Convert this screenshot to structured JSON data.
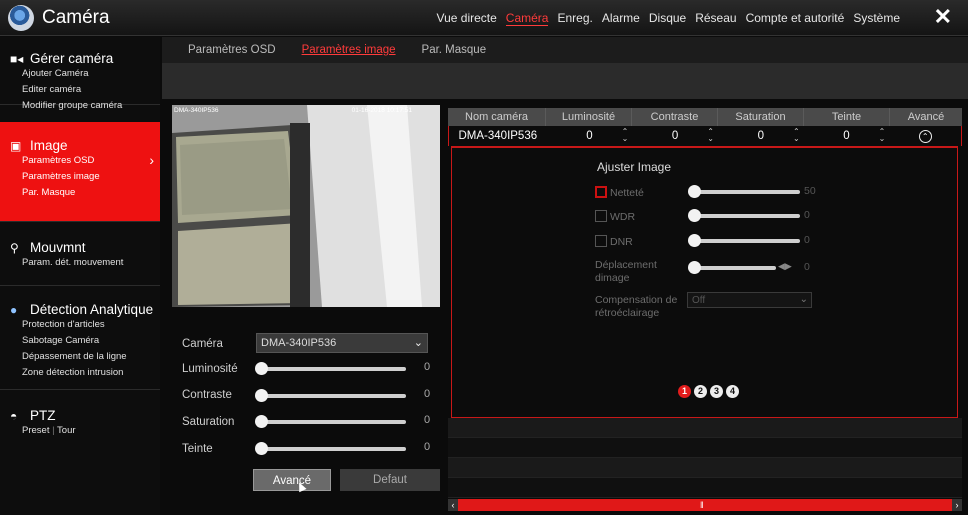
{
  "app": {
    "title": "Caméra"
  },
  "topnav": [
    "Vue directe",
    "Caméra",
    "Enreg.",
    "Alarme",
    "Disque",
    "Réseau",
    "Compte et autorité",
    "Système"
  ],
  "topnav_active": 1,
  "sidebar": {
    "gerer": {
      "title": "Gérer caméra",
      "items": [
        "Ajouter Caméra",
        "Editer caméra",
        "Modifier groupe caméra"
      ]
    },
    "image": {
      "title": "Image",
      "items": [
        "Paramètres OSD",
        "Paramètres image",
        "Par. Masque"
      ]
    },
    "mouvement": {
      "title": "Mouvmnt",
      "items": [
        "Param. dét. mouvement"
      ]
    },
    "detection": {
      "title": "Détection Analytique",
      "items": [
        "Protection d'articles",
        "Sabotage Caméra",
        "Dépassement de la ligne",
        "Zone détection intrusion"
      ]
    },
    "ptz": {
      "title": "PTZ",
      "items": [
        "Preset",
        "Tour"
      ],
      "separator": "|"
    }
  },
  "subtabs": [
    "Paramètres OSD",
    "Paramètres image",
    "Par. Masque"
  ],
  "subtabs_active": 1,
  "preview": {
    "osd_name": "DMA-340IP536",
    "osd_time": "01-16-2018 10:17:51"
  },
  "form": {
    "camera_label": "Caméra",
    "camera_value": "DMA-340IP536",
    "luminosite_label": "Luminosité",
    "luminosite_value": "0",
    "contraste_label": "Contraste",
    "contraste_value": "0",
    "saturation_label": "Saturation",
    "saturation_value": "0",
    "teinte_label": "Teinte",
    "teinte_value": "0",
    "btn_avance": "Avancé",
    "btn_defaut": "Defaut"
  },
  "table": {
    "headers": [
      "Nom caméra",
      "Luminosité",
      "Contraste",
      "Saturation",
      "Teinte",
      "Avancé"
    ],
    "row": {
      "name": "DMA-340IP536",
      "luminosite": "0",
      "contraste": "0",
      "saturation": "0",
      "teinte": "0"
    }
  },
  "advanced": {
    "title": "Ajuster Image",
    "nettete_label": "Netteté",
    "nettete_value": "50",
    "wdr_label": "WDR",
    "wdr_value": "0",
    "dnr_label": "DNR",
    "dnr_value": "0",
    "deplacement_label_1": "Déplacement",
    "deplacement_label_2": "dimage",
    "deplacement_value": "0",
    "compensation_label_1": "Compensation de",
    "compensation_label_2": "rétroéclairage",
    "compensation_value": "Off",
    "pages": [
      "1",
      "2",
      "3",
      "4"
    ],
    "active_page": 0
  },
  "colors": {
    "accent": "#ee1111",
    "background": "#0b0b0b"
  }
}
